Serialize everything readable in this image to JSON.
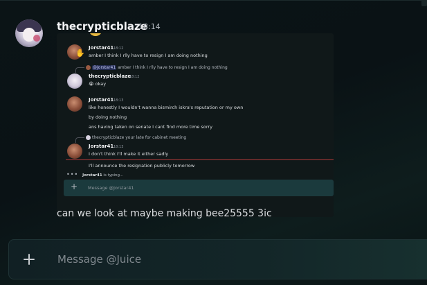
{
  "message": {
    "author": "thecrypticblaze",
    "timestamp": "18:14",
    "text": "can we look at maybe making bee25555 3ic"
  },
  "attachment": {
    "messages": [
      {
        "author": "Jorstar41",
        "time": "18:12",
        "lines": [
          "amber I think I rlly have to resign I am doing nothing"
        ]
      },
      {
        "reply_to": "@Jorstar41",
        "reply_text": "amber I think I rlly have to resign I am doing nothing",
        "author": "thecrypticblaze",
        "time": "18:12",
        "lines": [
          "okay"
        ]
      },
      {
        "author": "Jorstar41",
        "time": "18:13",
        "lines": [
          "like honestly I wouldn't wanna bismirch iskra's reputation or my own",
          "by doing nothing",
          "ans having taken on senate I cant find more time sorry"
        ]
      },
      {
        "reply_to": "thecrypticblaze",
        "reply_text": "your late for cabinet meeting",
        "author": "Jorstar41",
        "time": "18:13",
        "lines": [
          "I don't think I'll make it either sadly"
        ]
      },
      {
        "lines": [
          "I'll announce the resignation publicly tomorrow"
        ]
      }
    ],
    "typing": {
      "who": "Jorstar41",
      "suffix": " is typing..."
    },
    "input_placeholder": "Message @Jorstar41"
  },
  "chatbar": {
    "placeholder": "Message @Juice"
  },
  "icons": [
    "plus-icon",
    "cursor-icon",
    "emoji-icon"
  ]
}
